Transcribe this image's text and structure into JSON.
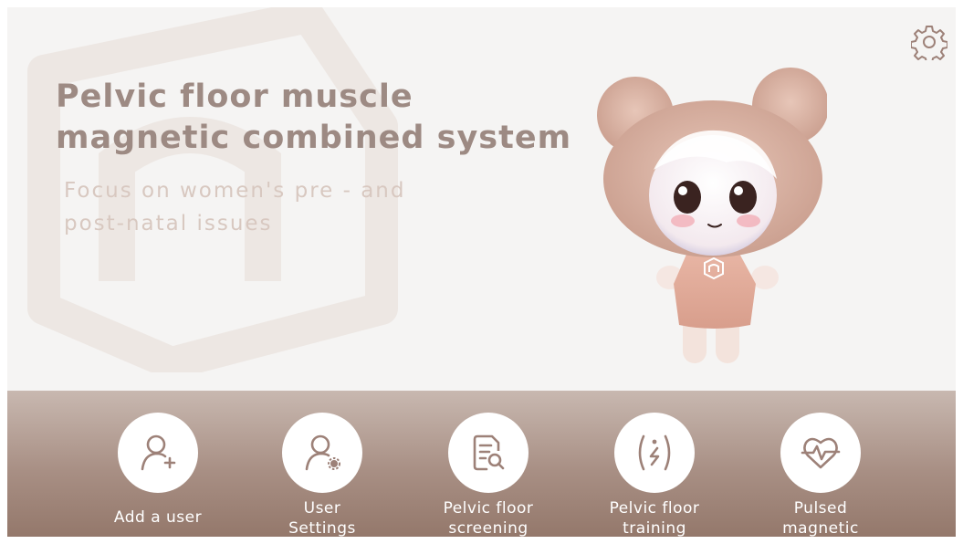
{
  "header": {
    "title_line1": "Pelvic floor muscle",
    "title_line2": "magnetic combined system",
    "subtitle_line1": "Focus on women's pre - and",
    "subtitle_line2": "post-natal issues"
  },
  "settings": {
    "icon": "gear-icon"
  },
  "mascot": {
    "description_icon": "mascot-character"
  },
  "menu": {
    "items": [
      {
        "line1": "Add a user",
        "line2": "",
        "icon": "add-user-icon"
      },
      {
        "line1": "User",
        "line2": "Settings",
        "icon": "user-settings-icon"
      },
      {
        "line1": "Pelvic floor",
        "line2": "screening",
        "icon": "document-search-icon"
      },
      {
        "line1": "Pelvic floor",
        "line2": "training",
        "icon": "pelvic-training-icon"
      },
      {
        "line1": "Pulsed",
        "line2": "magnetic",
        "icon": "heart-pulse-icon"
      }
    ]
  },
  "colors": {
    "title": "#9d8a83",
    "subtitle": "#d8c8c0",
    "bar_top": "#c8b8b0",
    "bar_bottom": "#94786b",
    "icon": "#9d8178"
  }
}
